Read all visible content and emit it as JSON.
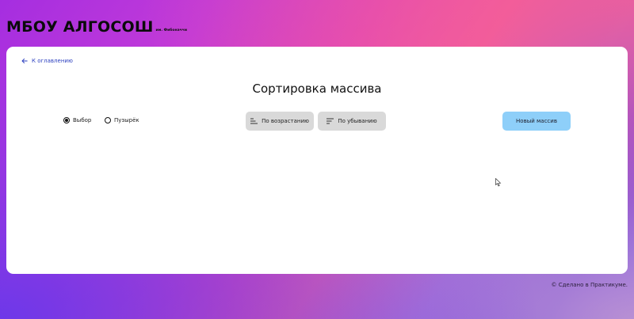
{
  "header": {
    "title": "МБОУ АЛГОСОШ",
    "subtitle": "им. Фибоначчи"
  },
  "nav": {
    "back_label": "К оглавлению"
  },
  "main": {
    "title": "Сортировка массива",
    "algorithm_options": [
      {
        "label": "Выбор",
        "selected": true
      },
      {
        "label": "Пузырёк",
        "selected": false
      }
    ],
    "buttons": {
      "ascending": "По возрастанию",
      "descending": "По убыванию",
      "new_array": "Новый массив"
    }
  },
  "footer": {
    "text": "© Сделано в Практикуме."
  },
  "colors": {
    "accent_link": "#2b3fbf",
    "button_gray": "#d9d9d9",
    "button_primary": "#8ecff9"
  },
  "icons": {
    "back": "arrow-left-icon",
    "ascending": "sort-ascending-icon",
    "descending": "sort-descending-icon"
  }
}
